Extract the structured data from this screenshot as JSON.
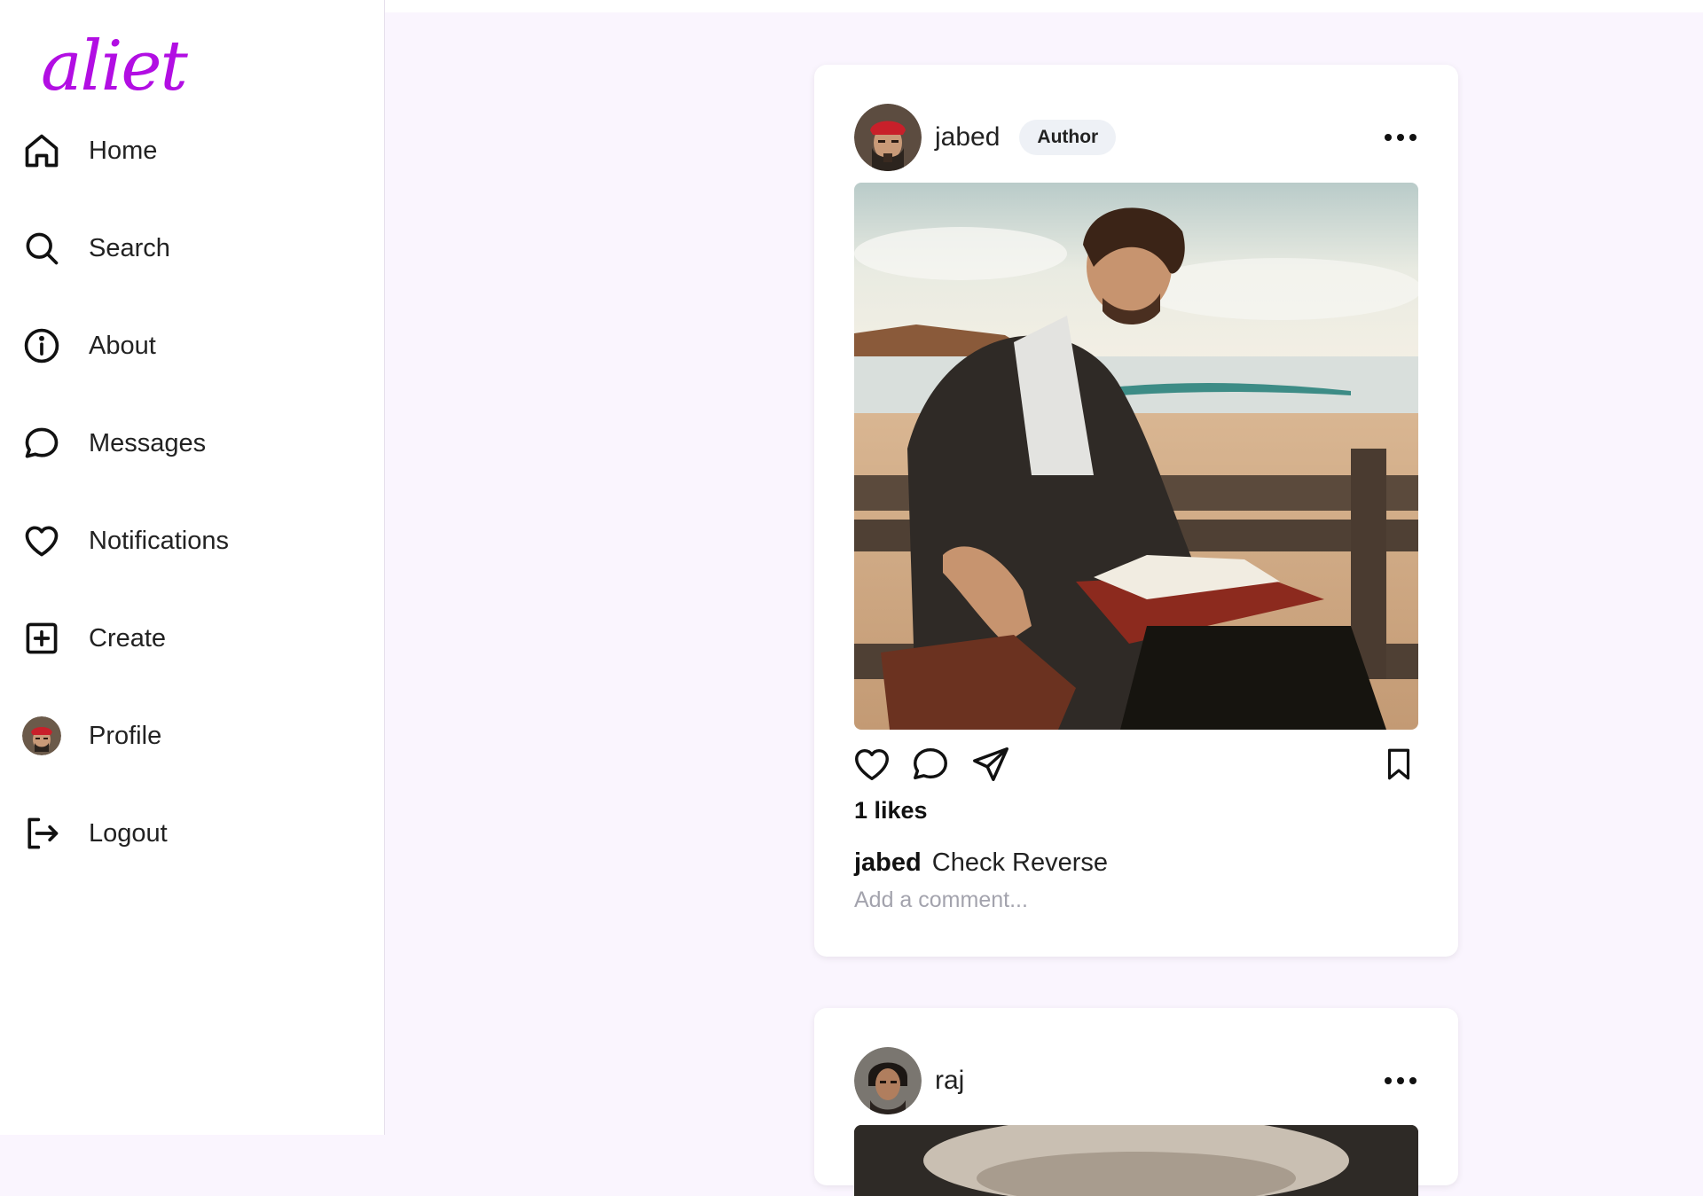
{
  "brand": {
    "logo_text": "aliet",
    "accent_color": "#b20ee3"
  },
  "sidebar": {
    "items": [
      {
        "label": "Home",
        "icon": "home-icon"
      },
      {
        "label": "Search",
        "icon": "search-icon"
      },
      {
        "label": "About",
        "icon": "info-icon"
      },
      {
        "label": "Messages",
        "icon": "message-icon"
      },
      {
        "label": "Notifications",
        "icon": "heart-icon"
      },
      {
        "label": "Create",
        "icon": "plus-square-icon"
      },
      {
        "label": "Profile",
        "icon": "avatar"
      },
      {
        "label": "Logout",
        "icon": "logout-icon"
      }
    ]
  },
  "feed": {
    "posts": [
      {
        "username": "jabed",
        "badge": "Author",
        "likes": "1 likes",
        "caption_user": "jabed",
        "caption_text": "Check Reverse",
        "comment_placeholder": "Add a comment..."
      },
      {
        "username": "raj"
      }
    ]
  }
}
